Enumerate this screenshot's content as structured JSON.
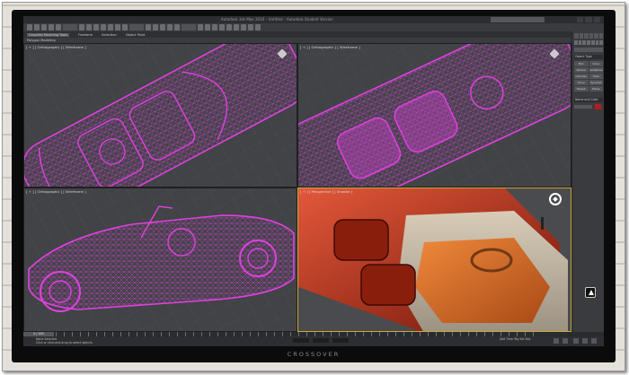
{
  "monitor": {
    "brand": "CROSSOVER"
  },
  "app": {
    "title": "Autodesk 3ds Max 2016 – Untitled – Autodesk Student Version",
    "ribbon_tabs": [
      "Graphite Modeling Tools",
      "Freeform",
      "Selection",
      "Object Paint"
    ],
    "ribbon_subtitle": "Polygon Modeling"
  },
  "viewports": [
    {
      "label": "[ + ] [ Orthographic ] [ Wireframe ]",
      "shading": "wireframe",
      "active": false
    },
    {
      "label": "[ + ] [ Orthographic ] [ Wireframe ]",
      "shading": "wireframe",
      "active": false
    },
    {
      "label": "[ + ] [ Orthographic ] [ Wireframe ]",
      "shading": "wireframe",
      "active": false
    },
    {
      "label": "[ + ] [ Perspective ] [ Shaded ]",
      "shading": "shaded",
      "active": true
    }
  ],
  "command_panel": {
    "rollout_object_type": "Object Type",
    "object_buttons": [
      "Box",
      "Cone",
      "Sphere",
      "GeoSphere",
      "Cylinder",
      "Tube",
      "Torus",
      "Pyramid",
      "Teapot",
      "Plane"
    ],
    "rollout_name_color": "Name and Color",
    "object_color": "#b71c1c"
  },
  "timeline": {
    "frame": "0 / 100"
  },
  "status": {
    "line1": "None Selected",
    "line2": "Click or click-and-drag to select objects",
    "keys": "Add Time Tag   Set Key"
  },
  "colors": {
    "wire": "#e040e0",
    "viewport_bg": "#414346",
    "shaded_red": "#c0391e",
    "shaded_tan": "#c8bca8"
  }
}
